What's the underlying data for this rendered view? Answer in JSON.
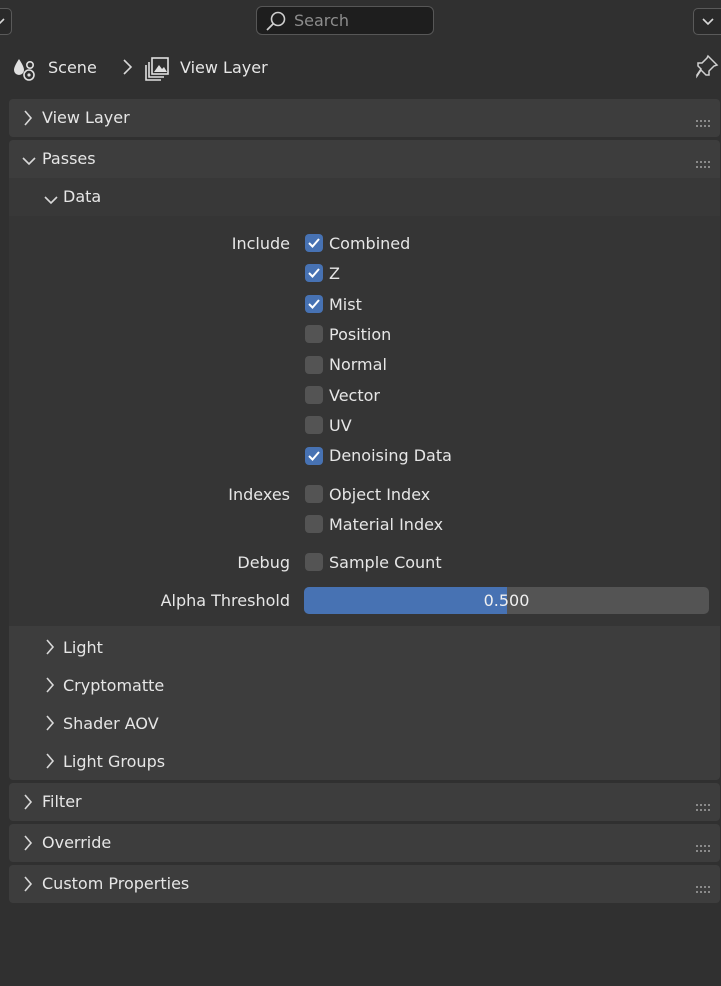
{
  "header": {
    "search_placeholder": "Search"
  },
  "breadcrumb": {
    "scene": "Scene",
    "view_layer": "View Layer"
  },
  "panels": {
    "view_layer": "View Layer",
    "passes": "Passes",
    "filter": "Filter",
    "override": "Override",
    "custom_properties": "Custom Properties"
  },
  "passes": {
    "data": {
      "title": "Data",
      "include_label": "Include",
      "include": [
        {
          "label": "Combined",
          "checked": true
        },
        {
          "label": "Z",
          "checked": true
        },
        {
          "label": "Mist",
          "checked": true
        },
        {
          "label": "Position",
          "checked": false
        },
        {
          "label": "Normal",
          "checked": false
        },
        {
          "label": "Vector",
          "checked": false
        },
        {
          "label": "UV",
          "checked": false
        },
        {
          "label": "Denoising Data",
          "checked": true
        }
      ],
      "indexes_label": "Indexes",
      "indexes": [
        {
          "label": "Object Index",
          "checked": false
        },
        {
          "label": "Material Index",
          "checked": false
        }
      ],
      "debug_label": "Debug",
      "debug": [
        {
          "label": "Sample Count",
          "checked": false
        }
      ],
      "alpha_threshold_label": "Alpha Threshold",
      "alpha_threshold_value": "0.500",
      "alpha_threshold_fraction": 0.5
    },
    "subpanels": [
      "Light",
      "Cryptomatte",
      "Shader AOV",
      "Light Groups"
    ]
  },
  "colors": {
    "accent": "#4772b3",
    "background": "#303030",
    "panel": "#3d3d3d"
  }
}
